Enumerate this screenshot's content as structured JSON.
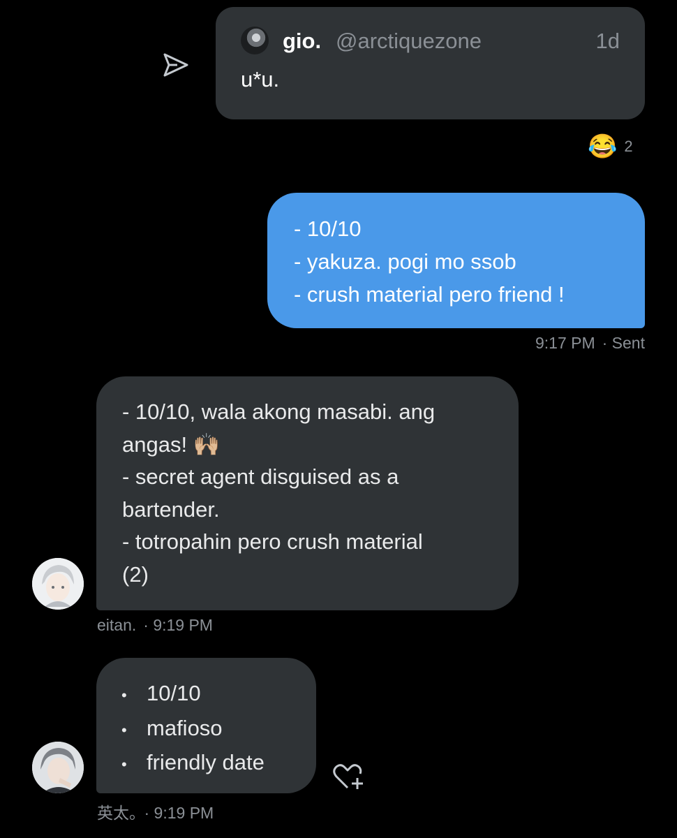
{
  "quote": {
    "name": "gio.",
    "handle": "@arctiquezone",
    "time": "1d",
    "text": "u*u.",
    "reaction": {
      "emoji": "😂",
      "count": "2"
    }
  },
  "sent": {
    "lines": [
      "- 10/10",
      "- yakuza. pogi mo ssob",
      "- crush material pero friend !"
    ],
    "time": "9:17 PM",
    "status": "· Sent"
  },
  "received": [
    {
      "lines": [
        "- 10/10, wala akong masabi. ang",
        "angas! 🙌🏼",
        "- secret agent disguised as a",
        "bartender.",
        "- totropahin pero crush material",
        "(2)"
      ],
      "sender": "eitan.",
      "time": "· 9:19 PM"
    },
    {
      "bullets": [
        "10/10",
        "mafioso",
        "friendly date"
      ],
      "bullet_char": "•",
      "sender": "英太。",
      "time": "· 9:19 PM"
    }
  ],
  "colors": {
    "background": "#000000",
    "sent_bubble": "#4a99e9",
    "received_bubble": "#2f3336",
    "muted_text": "#8b9096"
  }
}
